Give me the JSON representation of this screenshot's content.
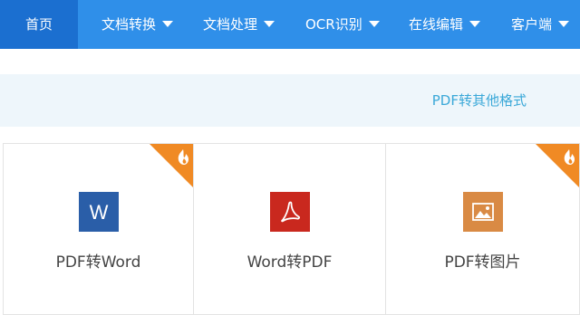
{
  "nav": {
    "items": [
      {
        "label": "首页",
        "active": true
      },
      {
        "label": "文档转换",
        "dropdown": true
      },
      {
        "label": "文档处理",
        "dropdown": true
      },
      {
        "label": "OCR识别",
        "dropdown": true
      },
      {
        "label": "在线编辑",
        "dropdown": true
      },
      {
        "label": "客户端",
        "dropdown": true
      }
    ]
  },
  "subbar": {
    "label": "PDF转其他格式"
  },
  "cards": [
    {
      "label": "PDF转Word",
      "icon": "word-icon",
      "icon_color": "#2a5ea8",
      "icon_glyph": "W",
      "hot": true
    },
    {
      "label": "Word转PDF",
      "icon": "pdf-icon",
      "icon_color": "#c9281e",
      "hot": false
    },
    {
      "label": "PDF转图片",
      "icon": "image-icon",
      "icon_color": "#d98a44",
      "hot": true
    }
  ],
  "colors": {
    "nav_bg": "#2f8fe9",
    "nav_active": "#1b6fd0",
    "subbar_bg": "#eef6fb",
    "subbar_text": "#3aa8d8",
    "hot_ribbon": "#f08a24"
  }
}
